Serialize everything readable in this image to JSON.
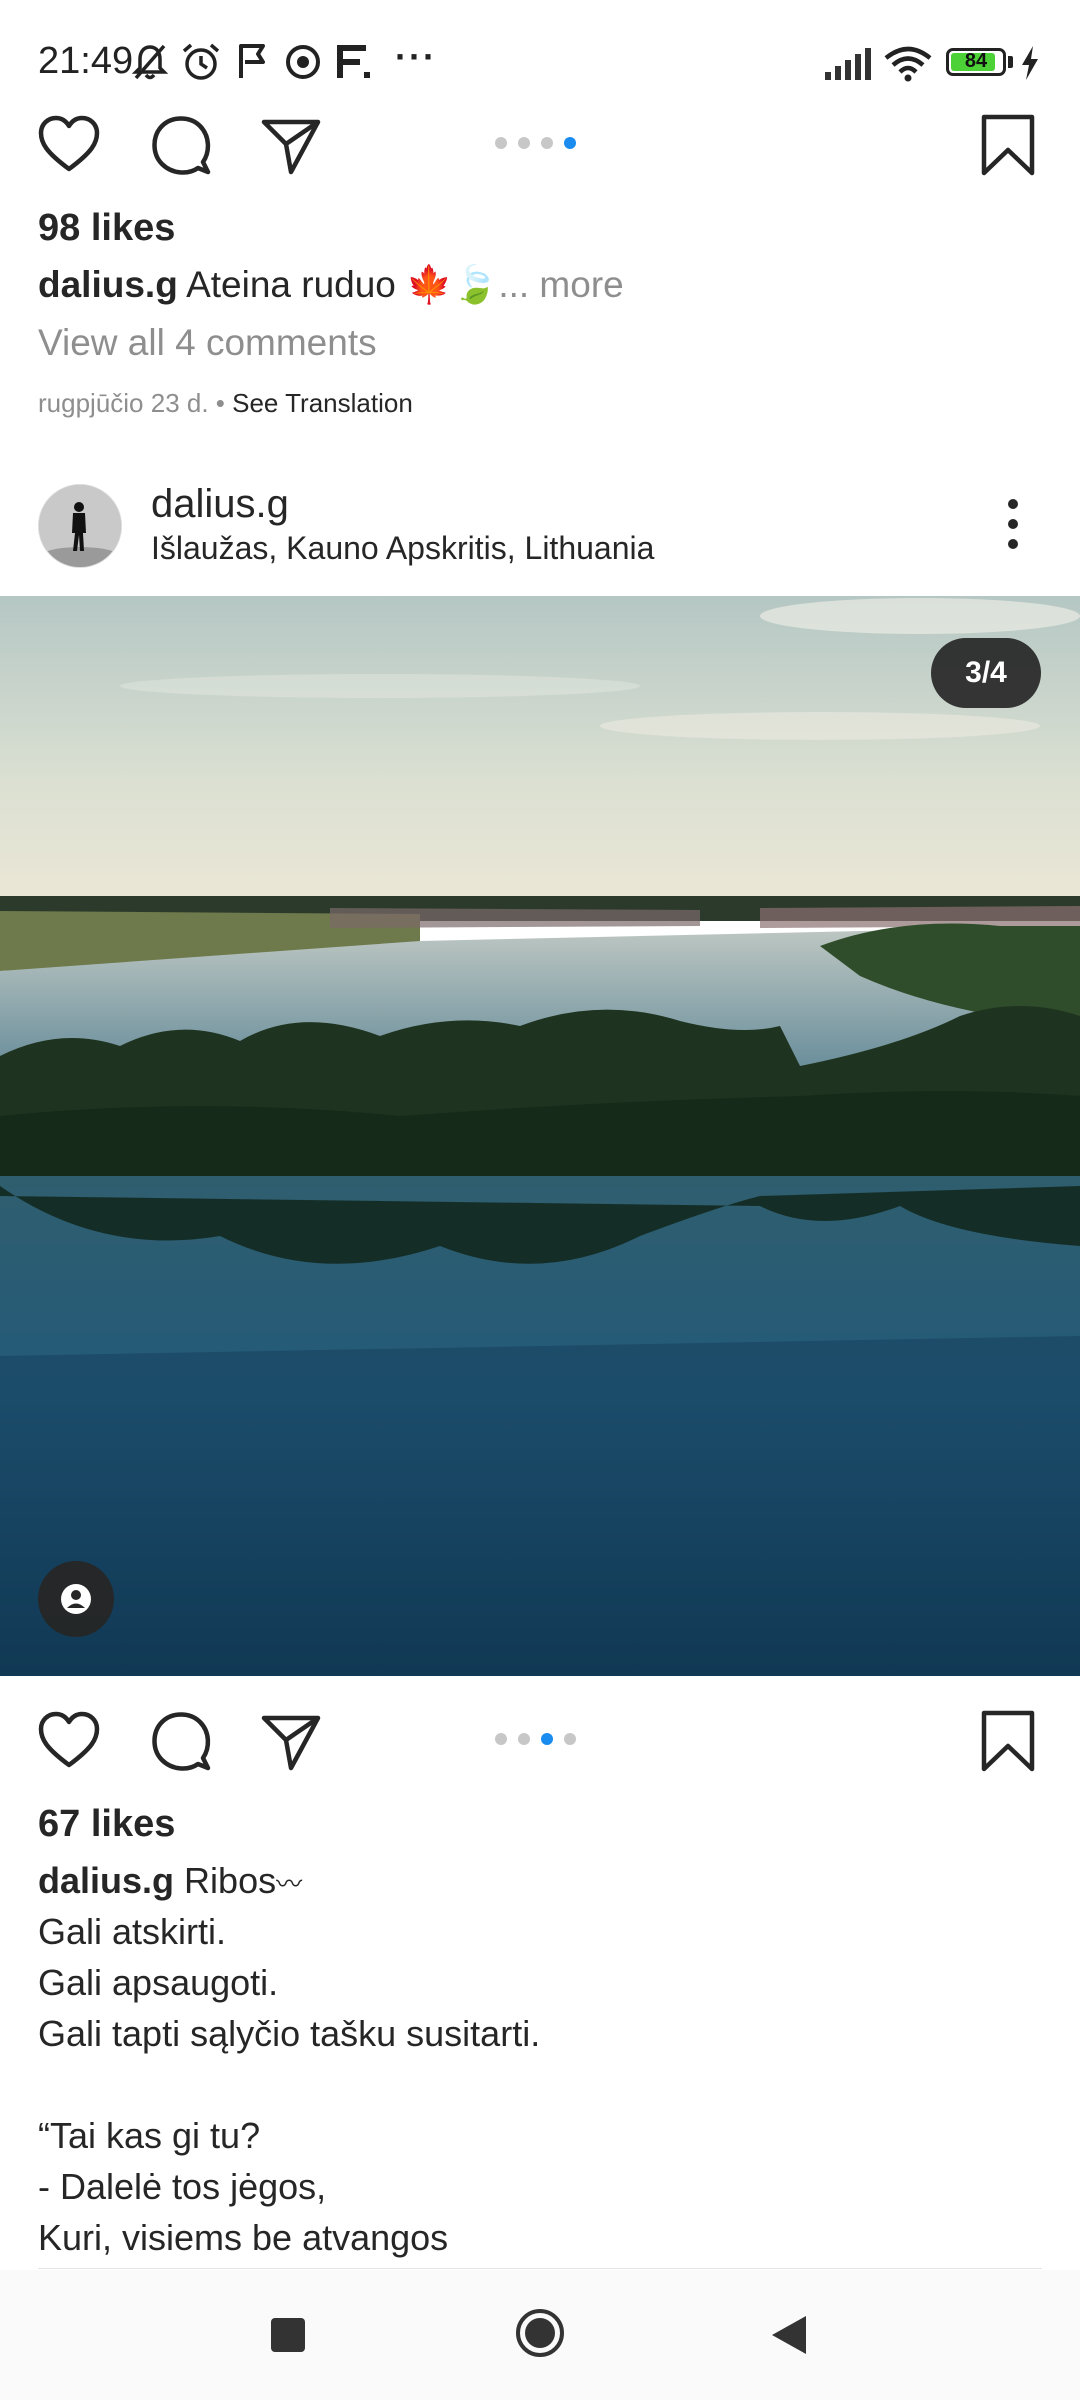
{
  "status_bar": {
    "time": "21:49",
    "battery_level": 84,
    "battery_text": "84",
    "icons": [
      "mute-icon",
      "alarm-icon",
      "flag-icon",
      "screen-record-icon",
      "f-app-icon",
      "more-notifications-icon",
      "signal-icon",
      "wifi-icon",
      "battery-icon",
      "charging-icon"
    ],
    "overflow": "···"
  },
  "post1": {
    "likes": "98 likes",
    "username": "dalius.g",
    "caption": "Ateina ruduo 🍁🍃",
    "more": "... more",
    "view_comments": "View all 4 comments",
    "date": "rugpjūčio 23 d.",
    "separator": " • ",
    "see_translation": "See Translation",
    "carousel_total": 4,
    "carousel_active": 4
  },
  "post2": {
    "username": "dalius.g",
    "location": "Išlaužas, Kauno Apskritis, Lithuania",
    "counter": "3/4",
    "likes": "67 likes",
    "caption_first": "Ribos",
    "caption_wave": "〰",
    "caption_lines": [
      "Gali atskirti.",
      "Gali apsaugoti.",
      "Gali tapti sąlyčio tašku susitarti.",
      "",
      "“Tai kas gi tu?",
      "- Dalelė tos jėgos,",
      "Kuri, visiems be atvangos"
    ],
    "carousel_total": 4,
    "carousel_active": 3
  },
  "colors": {
    "accent_blue": "#1a8cf0",
    "text": "#262626",
    "muted": "#8e8e8e",
    "battery_green": "#4cd137"
  },
  "nav": {
    "icons": [
      "recents-icon",
      "home-icon",
      "back-icon"
    ]
  }
}
